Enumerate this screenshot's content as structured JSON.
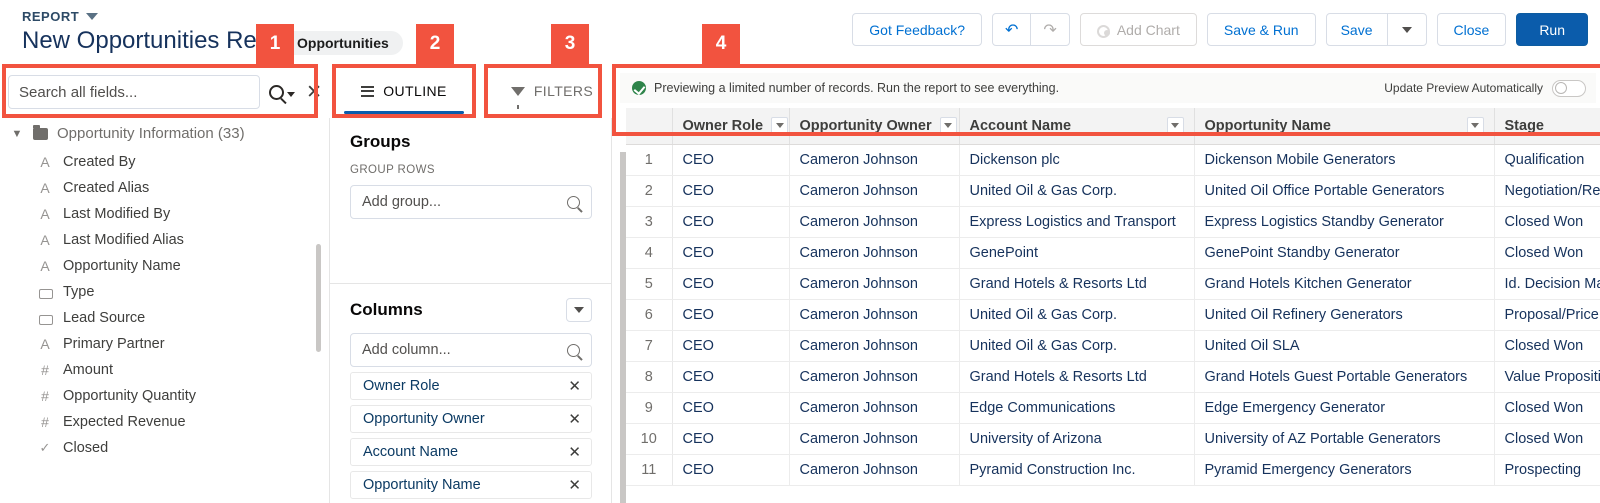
{
  "header": {
    "kicker": "REPORT",
    "title": "New Opportunities Report",
    "object_pill": "Opportunities",
    "toolbar": {
      "feedback": "Got Feedback?",
      "undo_icon": "undo-icon",
      "redo_icon": "redo-icon",
      "add_chart": "Add Chart",
      "save_and_run": "Save & Run",
      "save": "Save",
      "save_menu_icon": "chevron-down-icon",
      "close": "Close",
      "run": "Run"
    }
  },
  "search": {
    "placeholder": "Search all fields...",
    "search_icon": "search-icon",
    "clear_icon": "close-icon"
  },
  "fields_panel": {
    "folder": "Opportunity Information (33)",
    "expand_icon": "chevron-down-icon",
    "folder_icon": "folder-icon",
    "fields": [
      {
        "label": "Created By",
        "type": "text"
      },
      {
        "label": "Created Alias",
        "type": "text"
      },
      {
        "label": "Last Modified By",
        "type": "text"
      },
      {
        "label": "Last Modified Alias",
        "type": "text"
      },
      {
        "label": "Opportunity Name",
        "type": "text"
      },
      {
        "label": "Type",
        "type": "picklist"
      },
      {
        "label": "Lead Source",
        "type": "picklist"
      },
      {
        "label": "Primary Partner",
        "type": "text"
      },
      {
        "label": "Amount",
        "type": "number"
      },
      {
        "label": "Opportunity Quantity",
        "type": "number"
      },
      {
        "label": "Expected Revenue",
        "type": "number"
      },
      {
        "label": "Closed",
        "type": "checkbox"
      }
    ]
  },
  "tabs": [
    {
      "label": "OUTLINE",
      "icon": "list-icon",
      "active": true
    },
    {
      "label": "FILTERS",
      "icon": "filter-icon",
      "active": false
    }
  ],
  "outline": {
    "groups": {
      "title": "Groups",
      "subtitle": "GROUP ROWS",
      "add_placeholder": "Add group...",
      "search_icon": "search-icon"
    },
    "columns": {
      "title": "Columns",
      "menu_icon": "chevron-down-icon",
      "add_placeholder": "Add column...",
      "search_icon": "search-icon",
      "items": [
        {
          "label": "Owner Role",
          "remove_icon": "close-icon"
        },
        {
          "label": "Opportunity Owner",
          "remove_icon": "close-icon"
        },
        {
          "label": "Account Name",
          "remove_icon": "close-icon"
        },
        {
          "label": "Opportunity Name",
          "remove_icon": "close-icon"
        }
      ]
    }
  },
  "preview": {
    "status_icon": "success-check-icon",
    "status_text": "Previewing a limited number of records. Run the report to see everything.",
    "toggle_label": "Update Preview Automatically",
    "toggle_state": "off"
  },
  "table": {
    "columns": [
      {
        "key": "row",
        "label": "",
        "has_menu": false
      },
      {
        "key": "owner_role",
        "label": "Owner Role",
        "has_menu": true
      },
      {
        "key": "opportunity_owner",
        "label": "Opportunity Owner",
        "has_menu": true
      },
      {
        "key": "account_name",
        "label": "Account Name",
        "has_menu": true
      },
      {
        "key": "opportunity_name",
        "label": "Opportunity Name",
        "has_menu": true
      },
      {
        "key": "stage",
        "label": "Stage",
        "has_menu": false
      }
    ],
    "rows": [
      {
        "row": "1",
        "owner_role": "CEO",
        "opportunity_owner": "Cameron Johnson",
        "account_name": "Dickenson plc",
        "opportunity_name": "Dickenson Mobile Generators",
        "stage": "Qualification"
      },
      {
        "row": "2",
        "owner_role": "CEO",
        "opportunity_owner": "Cameron Johnson",
        "account_name": "United Oil & Gas Corp.",
        "opportunity_name": "United Oil Office Portable Generators",
        "stage": "Negotiation/Review"
      },
      {
        "row": "3",
        "owner_role": "CEO",
        "opportunity_owner": "Cameron Johnson",
        "account_name": "Express Logistics and Transport",
        "opportunity_name": "Express Logistics Standby Generator",
        "stage": "Closed Won"
      },
      {
        "row": "4",
        "owner_role": "CEO",
        "opportunity_owner": "Cameron Johnson",
        "account_name": "GenePoint",
        "opportunity_name": "GenePoint Standby Generator",
        "stage": "Closed Won"
      },
      {
        "row": "5",
        "owner_role": "CEO",
        "opportunity_owner": "Cameron Johnson",
        "account_name": "Grand Hotels & Resorts Ltd",
        "opportunity_name": "Grand Hotels Kitchen Generator",
        "stage": "Id. Decision Makers"
      },
      {
        "row": "6",
        "owner_role": "CEO",
        "opportunity_owner": "Cameron Johnson",
        "account_name": "United Oil & Gas Corp.",
        "opportunity_name": "United Oil Refinery Generators",
        "stage": "Proposal/Price Quote"
      },
      {
        "row": "7",
        "owner_role": "CEO",
        "opportunity_owner": "Cameron Johnson",
        "account_name": "United Oil & Gas Corp.",
        "opportunity_name": "United Oil SLA",
        "stage": "Closed Won"
      },
      {
        "row": "8",
        "owner_role": "CEO",
        "opportunity_owner": "Cameron Johnson",
        "account_name": "Grand Hotels & Resorts Ltd",
        "opportunity_name": "Grand Hotels Guest Portable Generators",
        "stage": "Value Proposition"
      },
      {
        "row": "9",
        "owner_role": "CEO",
        "opportunity_owner": "Cameron Johnson",
        "account_name": "Edge Communications",
        "opportunity_name": "Edge Emergency Generator",
        "stage": "Closed Won"
      },
      {
        "row": "10",
        "owner_role": "CEO",
        "opportunity_owner": "Cameron Johnson",
        "account_name": "University of Arizona",
        "opportunity_name": "University of AZ Portable Generators",
        "stage": "Closed Won"
      },
      {
        "row": "11",
        "owner_role": "CEO",
        "opportunity_owner": "Cameron Johnson",
        "account_name": "Pyramid Construction Inc.",
        "opportunity_name": "Pyramid Emergency Generators",
        "stage": "Prospecting"
      }
    ]
  },
  "callouts": [
    {
      "number": "1",
      "target": "search-all-fields"
    },
    {
      "number": "2",
      "target": "outline-tab"
    },
    {
      "number": "3",
      "target": "filters-tab"
    },
    {
      "number": "4",
      "target": "report-preview"
    }
  ],
  "colors": {
    "callout": "#f2533f",
    "primary_button": "#0b5cab",
    "link": "#0070d2",
    "active_tab_underline": "#0b5cab",
    "success": "#2e844a"
  }
}
